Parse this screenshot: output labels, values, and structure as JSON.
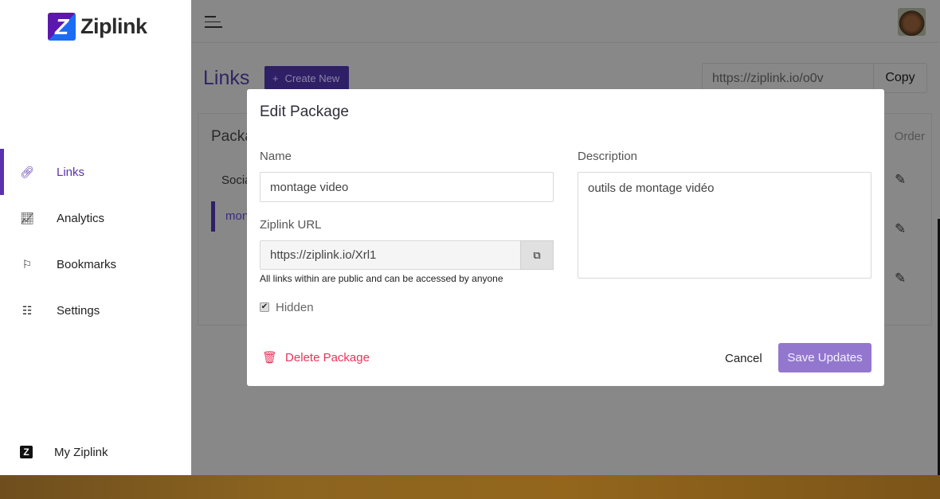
{
  "brand": {
    "name": "Ziplink",
    "logo_letter": "Z"
  },
  "sidebar": {
    "items": [
      {
        "label": "Links",
        "icon": "link-icon",
        "glyph": "🔗︎",
        "active": true
      },
      {
        "label": "Analytics",
        "icon": "chart-icon",
        "glyph": "📈︎"
      },
      {
        "label": "Bookmarks",
        "icon": "bookmark-icon",
        "glyph": "⚐"
      },
      {
        "label": "Settings",
        "icon": "sliders-icon",
        "glyph": "☷"
      }
    ],
    "footer": {
      "label": "My Ziplink",
      "icon": "ziplink-icon",
      "glyph": "Z"
    }
  },
  "header": {
    "menu_icon": "hamburger-icon",
    "avatar": "user-avatar"
  },
  "page": {
    "title": "Links",
    "create_label": "Create New",
    "create_glyph": "+",
    "share_url": "https://ziplink.io/o0v",
    "copy_label": "Copy"
  },
  "packages": {
    "heading": "Packa",
    "order_label": "Order",
    "rows": [
      "Socia",
      "mon"
    ],
    "edit_glyph": "✎"
  },
  "modal": {
    "title": "Edit Package",
    "name_label": "Name",
    "name_value": "montage video",
    "url_label": "Ziplink URL",
    "url_value": "https://ziplink.io/Xrl1",
    "copy_glyph": "⧉",
    "help": "All links within are public and can be accessed by anyone",
    "hidden_label": "Hidden",
    "hidden_checked": true,
    "check_glyph": "✔",
    "desc_label": "Description",
    "desc_value": "outils de montage vidéo",
    "delete_label": "Delete Package",
    "delete_glyph": "🗑︎",
    "cancel_label": "Cancel",
    "save_label": "Save Updates"
  },
  "colors": {
    "accent": "#5a32b0",
    "danger": "#e8345a",
    "save": "#9377cf"
  }
}
